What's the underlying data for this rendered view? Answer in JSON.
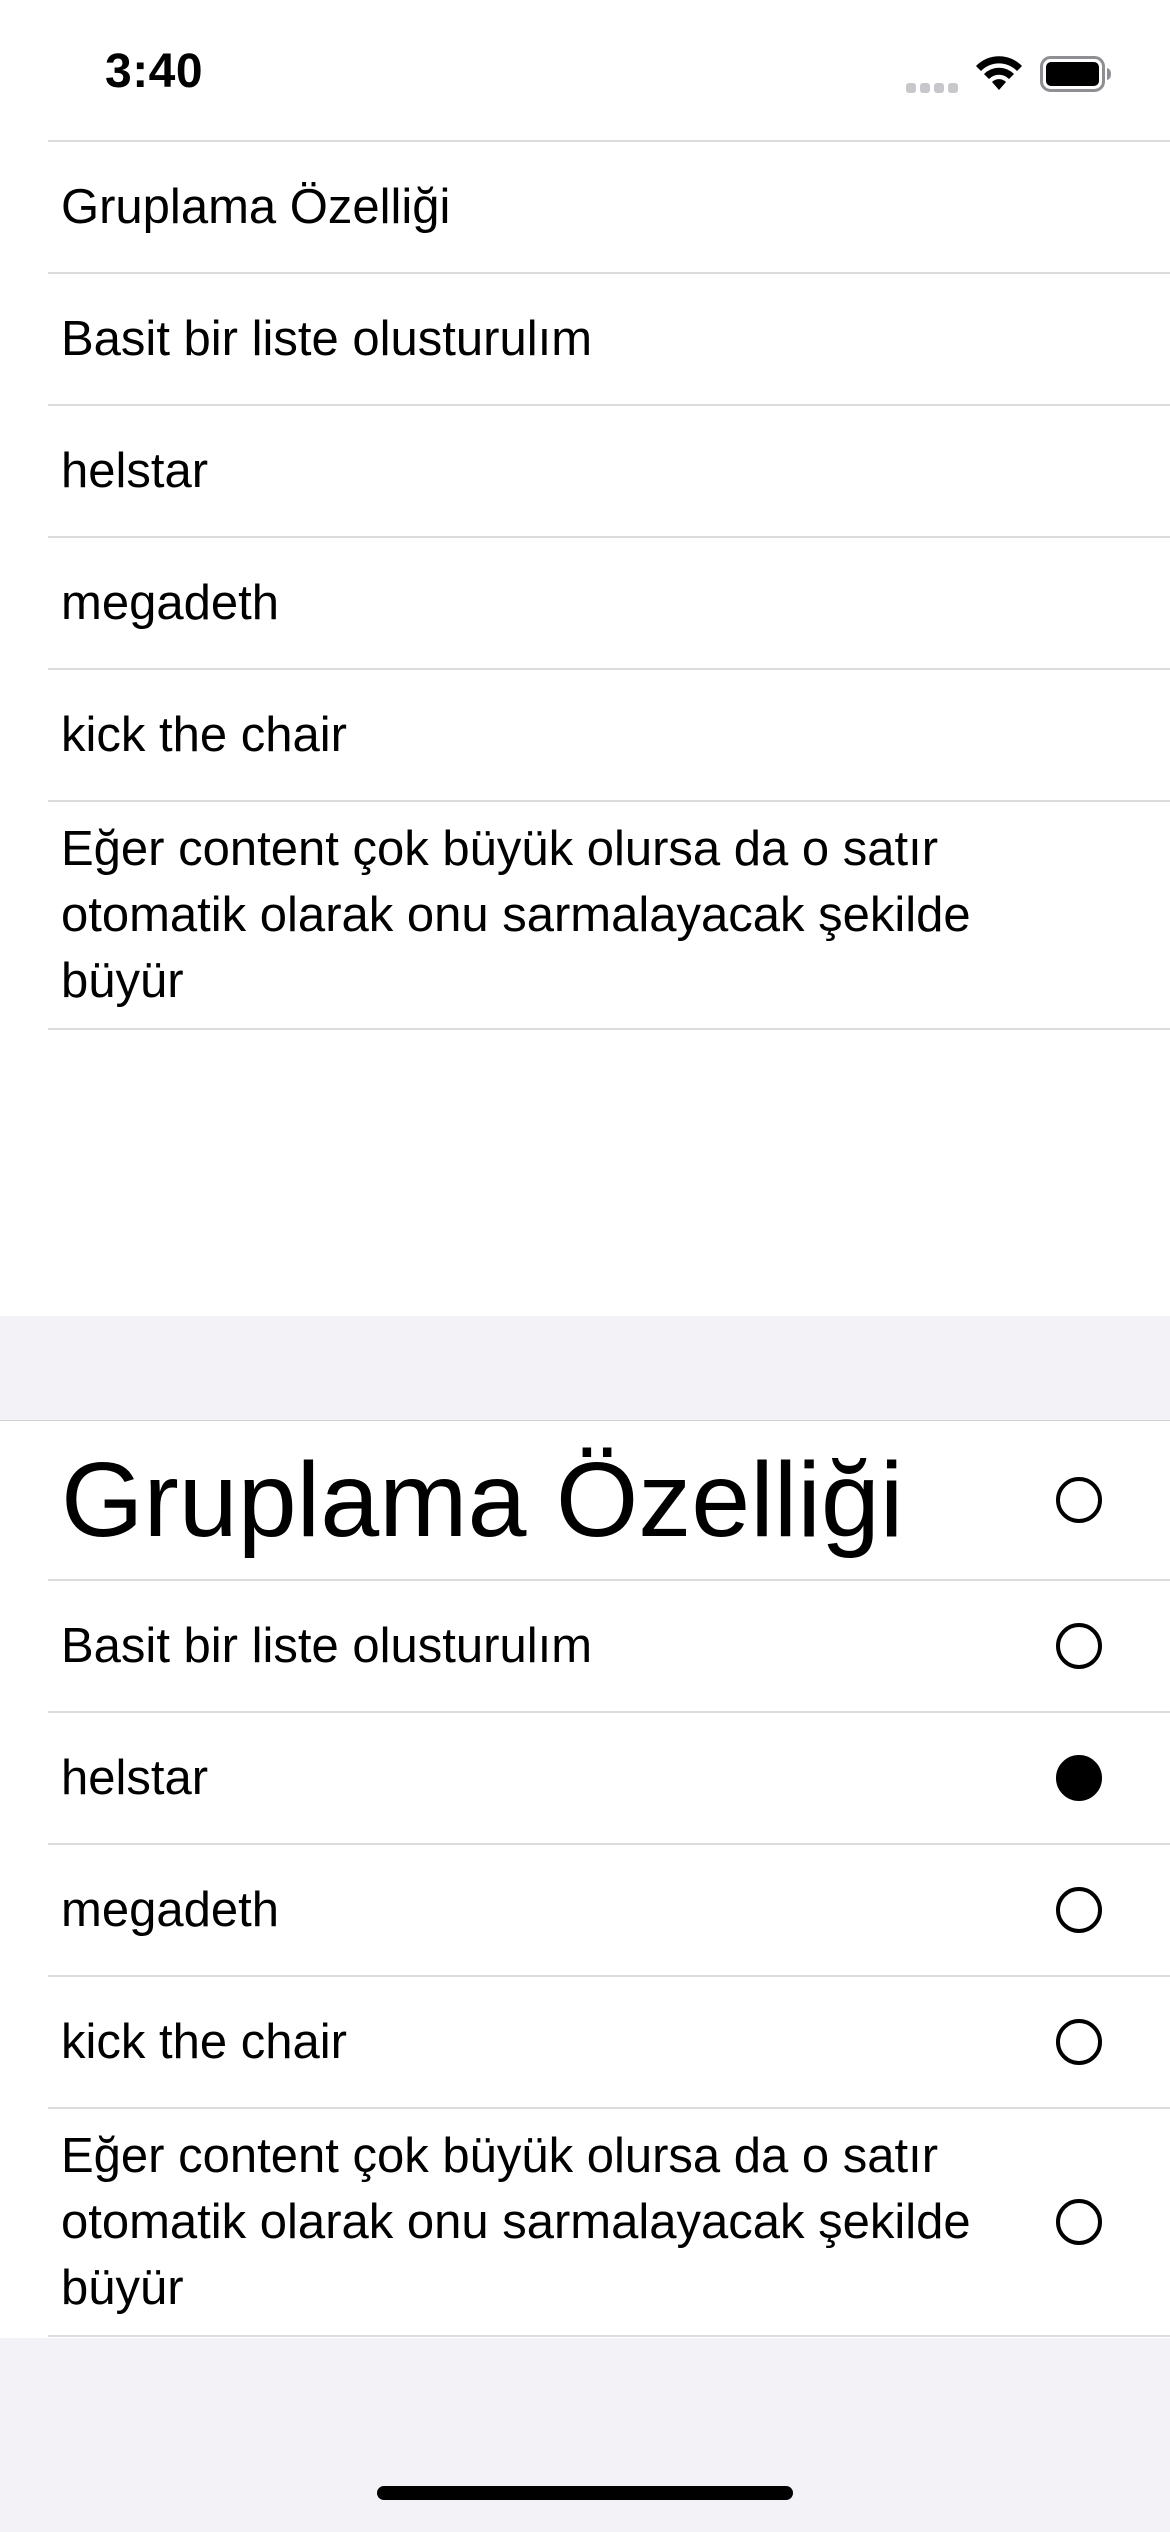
{
  "status_bar": {
    "time": "3:40",
    "icons": [
      "cellular-signal-icon",
      "wifi-icon",
      "battery-icon"
    ]
  },
  "top_list": {
    "items": [
      "Gruplama Özelliği",
      "Basit bir liste olusturulım",
      "helstar",
      "megadeth",
      "kick the chair",
      "Eğer content çok büyük olursa da o satır otomatik olarak onu sarmalayacak şekilde büyür"
    ]
  },
  "bottom_list": {
    "items": [
      {
        "label": "Gruplama Özelliği",
        "selected": false
      },
      {
        "label": "Basit bir liste olusturulım",
        "selected": false
      },
      {
        "label": "helstar",
        "selected": true
      },
      {
        "label": "megadeth",
        "selected": false
      },
      {
        "label": "kick the chair",
        "selected": false
      },
      {
        "label": "Eğer content çok büyük olursa da o satır otomatik olarak onu sarmalayacak şekilde büyür",
        "selected": false
      }
    ]
  },
  "colors": {
    "background": "#ffffff",
    "grouped_background": "#f2f2f7",
    "separator": "#dcdcdf",
    "text": "#000000"
  }
}
